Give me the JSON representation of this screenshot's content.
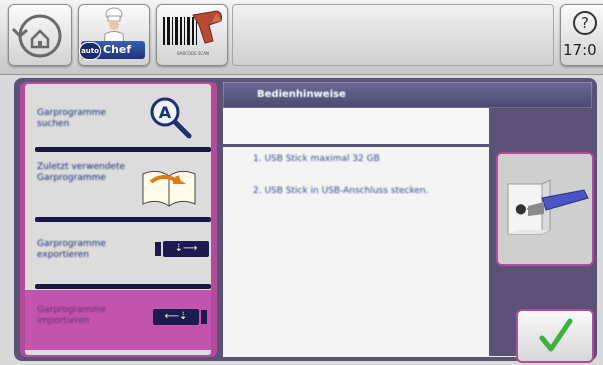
{
  "toolbar": {
    "home_button": "back-home",
    "chef_badge_auto": "auto",
    "chef_badge_text": "Chef",
    "barcode_caption": "BARCODE SCAN",
    "help_symbol": "?",
    "clock": "17:0"
  },
  "sidebar": {
    "items": [
      {
        "label": "Garprogramme suchen",
        "icon": "search-icon"
      },
      {
        "label": "Zuletzt verwendete Garprogramme",
        "icon": "book-icon"
      },
      {
        "label": "Garprogramme exportieren",
        "icon": "usb-export-icon"
      },
      {
        "label": "Garprogramme importieren",
        "icon": "usb-import-icon",
        "active": true
      }
    ]
  },
  "content": {
    "header": "Bedienhinweise",
    "hints": [
      "1. USB Stick maximal 32 GB",
      "2. USB Stick in USB-Anschluss stecken."
    ]
  },
  "colors": {
    "frame": "#5b5277",
    "accent": "#b24b9a",
    "confirm_check": "#3cb043"
  }
}
